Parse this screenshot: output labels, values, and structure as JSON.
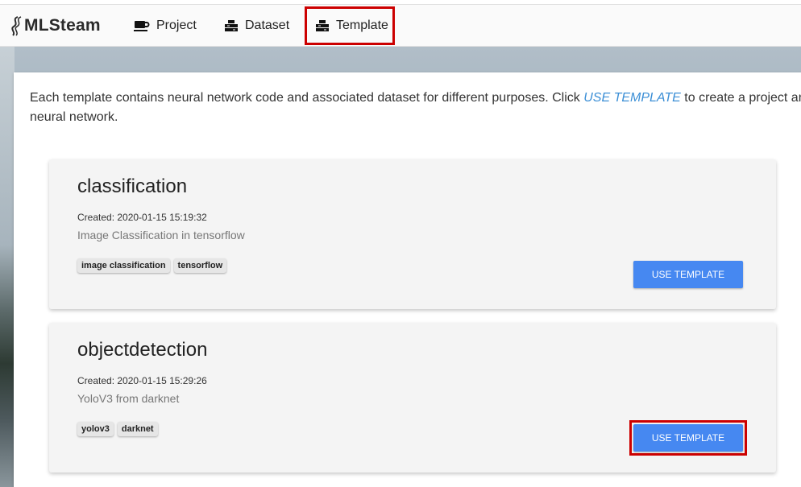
{
  "app": {
    "logo_text": "MLSteam"
  },
  "nav": {
    "items": [
      {
        "label": "Project",
        "icon": "coffee-cup-icon"
      },
      {
        "label": "Dataset",
        "icon": "dataset-stack-icon"
      },
      {
        "label": "Template",
        "icon": "template-stack-icon",
        "highlighted": true
      }
    ]
  },
  "intro": {
    "before_link": "Each template contains neural network code and associated dataset for different purposes. Click ",
    "link": "USE TEMPLATE",
    "after_link": " to create a project an",
    "line2": "neural network."
  },
  "templates": [
    {
      "name": "classification",
      "created": "Created: 2020-01-15 15:19:32",
      "description": "Image Classification in tensorflow",
      "tags": [
        "image classification",
        "tensorflow"
      ],
      "button": "USE TEMPLATE"
    },
    {
      "name": "objectdetection",
      "created": "Created: 2020-01-15 15:29:26",
      "description": "YoloV3 from darknet",
      "tags": [
        "yolov3",
        "darknet"
      ],
      "button": "USE TEMPLATE",
      "highlighted": true
    }
  ],
  "colors": {
    "accent": "#4688f1",
    "highlight": "#cc0000",
    "link": "#3c8fd6"
  }
}
